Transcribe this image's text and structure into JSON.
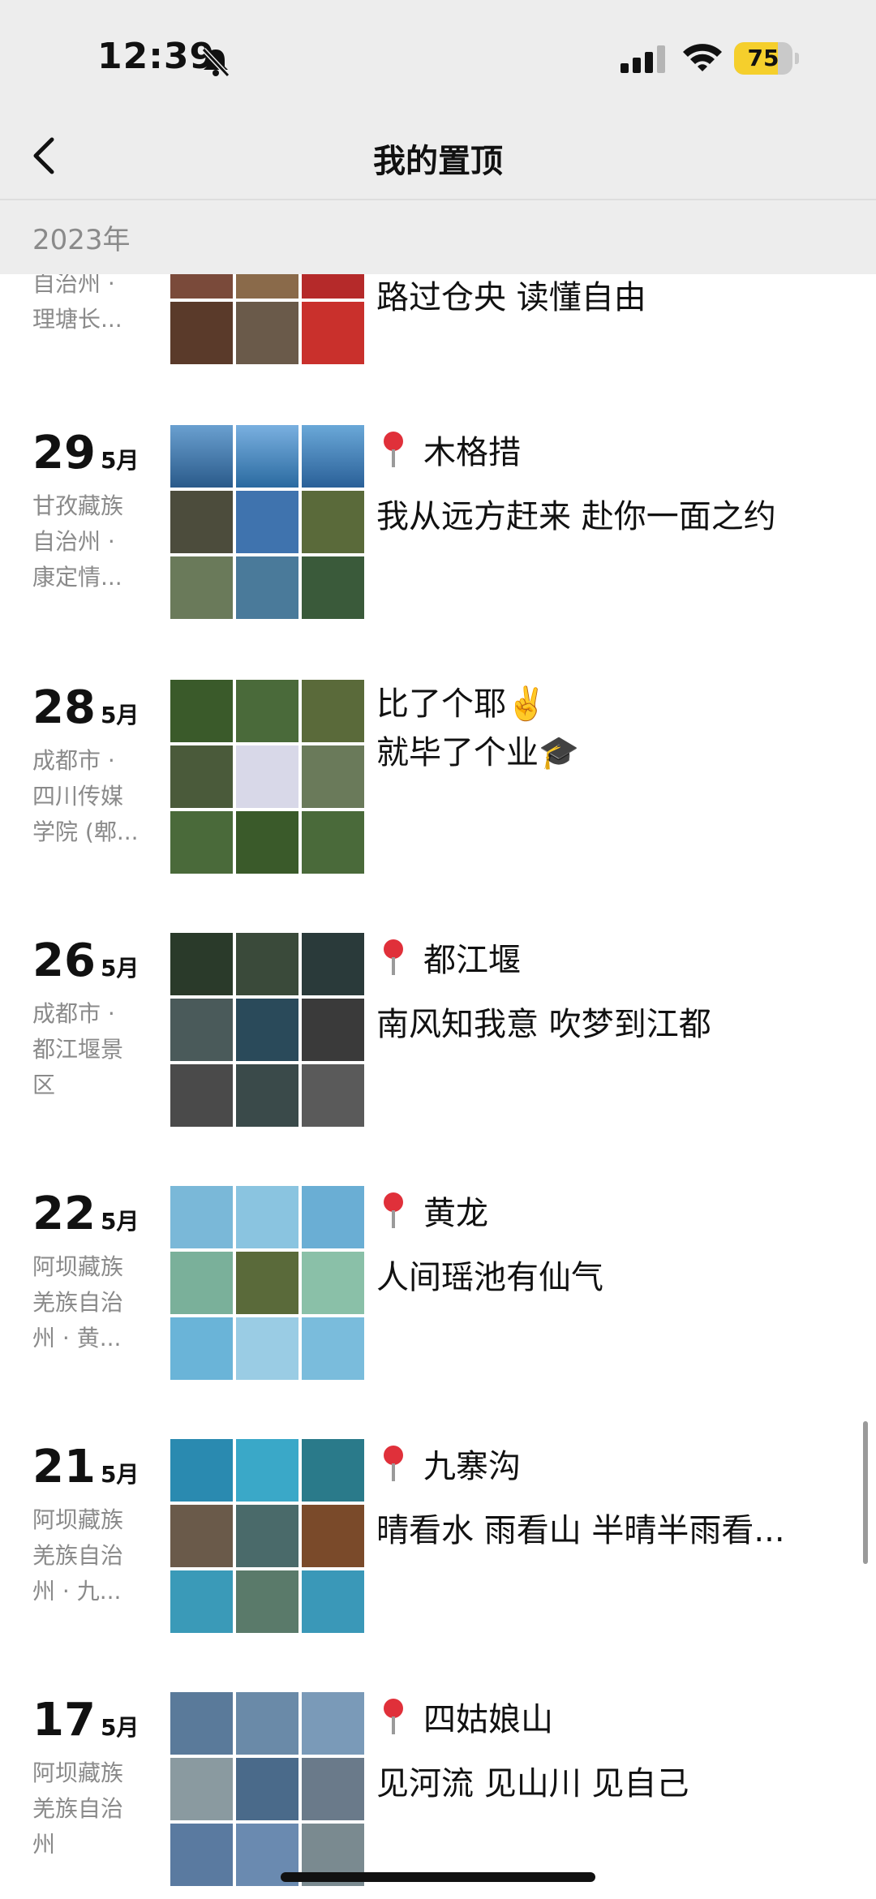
{
  "status": {
    "time": "12:39",
    "battery": "75",
    "battery_level": 0.75
  },
  "header": {
    "title": "我的置顶",
    "back_icon": "chevron-left-icon"
  },
  "year": "2023年",
  "entries": [
    {
      "day": "",
      "month": "",
      "location": [
        "自治州 ·",
        "理塘长..."
      ],
      "pin": "",
      "line1": "",
      "line2": "路过仓央 读懂自由",
      "colors": [
        "#6b3a2a",
        "#c47a3a",
        "#3a6ea8",
        "#7a4a3a",
        "#8a6a4a",
        "#b52a2a",
        "#5a3a2a",
        "#6a5a4a",
        "#c9302c"
      ]
    },
    {
      "day": "29",
      "month": "5月",
      "location": [
        "甘孜藏族",
        "自治州 ·",
        "康定情..."
      ],
      "pin": "📍",
      "line1": "木格措",
      "line2": "我从远方赶来 赴你一面之约",
      "colors": [
        "#3e78b8",
        "#4a86c4",
        "#3a70b0",
        "#4c4c3c",
        "#3f73ae",
        "#5a6a3a",
        "#6a7a5a",
        "#4a7a9a",
        "#3a5a3a"
      ]
    },
    {
      "day": "28",
      "month": "5月",
      "location": [
        "成都市 ·",
        "四川传媒",
        "学院 (郫..."
      ],
      "pin": "",
      "line1": "比了个耶✌️",
      "line2": "就毕了个业🎓",
      "colors": [
        "#3a5a2a",
        "#4a6a3a",
        "#5a6a3a",
        "#4a5a3a",
        "#d8d8e8",
        "#6a7a5a",
        "#4a6a3a",
        "#3a5a2a",
        "#4a6a3a"
      ]
    },
    {
      "day": "26",
      "month": "5月",
      "location": [
        "成都市 ·",
        "都江堰景",
        "区"
      ],
      "pin": "📍",
      "line1": "都江堰",
      "line2": "南风知我意 吹梦到江都",
      "colors": [
        "#2a3a2a",
        "#3a4a3a",
        "#2a3a3a",
        "#4a5a5a",
        "#2a4a5a",
        "#3a3a3a",
        "#4a4a4a",
        "#3a4a4a",
        "#5a5a5a"
      ]
    },
    {
      "day": "22",
      "month": "5月",
      "location": [
        "阿坝藏族",
        "羌族自治",
        "州 · 黄..."
      ],
      "pin": "📍",
      "line1": "黄龙",
      "line2": "人间瑶池有仙气",
      "colors": [
        "#7ab8d8",
        "#8ac4e0",
        "#6aaed4",
        "#7ab09a",
        "#5a6a3a",
        "#8ac0a8",
        "#6ab4d8",
        "#9acce4",
        "#7abcdc"
      ]
    },
    {
      "day": "21",
      "month": "5月",
      "location": [
        "阿坝藏族",
        "羌族自治",
        "州 · 九..."
      ],
      "pin": "📍",
      "line1": "九寨沟",
      "line2": "晴看水 雨看山 半晴半雨看...",
      "colors": [
        "#2a8ab0",
        "#3aa8c8",
        "#2a7a8a",
        "#6a5a4a",
        "#4a6a6a",
        "#7a4a2a",
        "#3a9ab8",
        "#5a7a6a",
        "#3a98b8"
      ]
    },
    {
      "day": "17",
      "month": "5月",
      "location": [
        "阿坝藏族",
        "羌族自治",
        "州"
      ],
      "pin": "📍",
      "line1": "四姑娘山",
      "line2": "见河流 见山川 见自己",
      "colors": [
        "#5a7a9a",
        "#6a8aa8",
        "#7a9ab8",
        "#8a9aa0",
        "#4a6a8a",
        "#6a7a8a",
        "#5a7aa0",
        "#6a8ab0",
        "#7a8a90"
      ]
    }
  ]
}
